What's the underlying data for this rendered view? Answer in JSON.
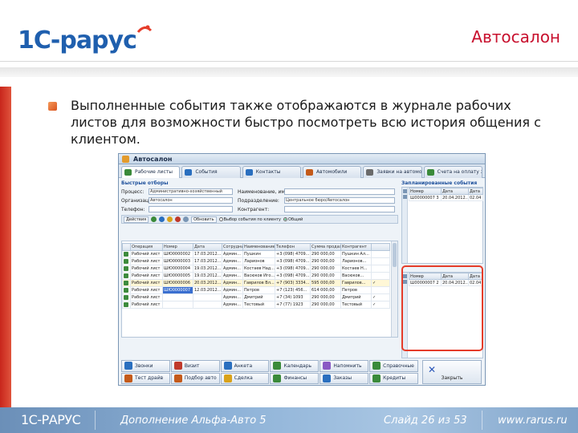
{
  "slide": {
    "logo_text": "1С-РАРУС",
    "title": "Автосалон",
    "bullet": "Выполненные события также отображаются в журнале рабочих листов для возможности быстро посмотреть всю история общения с клиентом."
  },
  "window": {
    "title": "Автосалон",
    "tabs": [
      {
        "label": "Рабочие листы",
        "icon_color": "#3a8a3a"
      },
      {
        "label": "События",
        "icon_color": "#2a6fbf"
      },
      {
        "label": "Контакты",
        "icon_color": "#2a6fbf"
      },
      {
        "label": "Автомобили",
        "icon_color": "#c45a1a"
      },
      {
        "label": "Заявки на автомобиль",
        "icon_color": "#6a6a6a"
      },
      {
        "label": "Счета на оплату за автомобиль",
        "icon_color": "#3a8a3a"
      }
    ],
    "filters": {
      "section_title": "Быстрые отборы",
      "rows": [
        {
          "label": "Процесс:",
          "value": "Административно-хозяйственный",
          "label2": "Наименование, имени:",
          "value2": ""
        },
        {
          "label": "Организация:",
          "value": "Автосалон",
          "label2": "Подразделение:",
          "value2": "Центральное бюро/Автосалон"
        },
        {
          "label": "Телефон:",
          "value": "",
          "label2": "Контрагент:",
          "value2": ""
        }
      ]
    },
    "toolbar": {
      "actions_label": "Действия",
      "refresh_label": "Обновить",
      "radio1": "Выбор события по клиенту",
      "radio2": "Общий"
    },
    "grid": {
      "columns": [
        "",
        "Операция",
        "Номер",
        "Дата",
        "Сотрудник",
        "Наименование",
        "Телефон",
        "Сумма продажи",
        "Контрагент",
        ""
      ],
      "rows": [
        {
          "op": "Рабочий лист",
          "num": "ШЮ0000002",
          "date": "17.03.2012...",
          "emp": "Админ...",
          "name": "Пушкин",
          "phone": "+3 (098) 4709...",
          "sum": "290 000,00",
          "cp": "Пушкин Ал...",
          "flag": ""
        },
        {
          "op": "Рабочий лист",
          "num": "ШЮ0000003",
          "date": "17.03.2012...",
          "emp": "Админ...",
          "name": "Ларионов",
          "phone": "+3 (098) 4709...",
          "sum": "290 000,00",
          "cp": "Ларионов...",
          "flag": ""
        },
        {
          "op": "Рабочий лист",
          "num": "ШЮ0000004",
          "date": "19.03.2012...",
          "emp": "Админ...",
          "name": "Костаев Над...",
          "phone": "+3 (098) 4709...",
          "sum": "290 000,00",
          "cp": "Костаев Н...",
          "flag": ""
        },
        {
          "op": "Рабочий лист",
          "num": "ШЮ0000005",
          "date": "19.03.2012...",
          "emp": "Админ...",
          "name": "Васюков Иго...",
          "phone": "+3 (098) 4709...",
          "sum": "290 000,00",
          "cp": "Васюков...",
          "flag": ""
        },
        {
          "op": "Рабочий лист",
          "num": "ШЮ0000006",
          "date": "20.03.2012...",
          "emp": "Админ...",
          "name": "Гаврилов Вл...",
          "phone": "+7 (903) 3334...",
          "sum": "595 000,00",
          "cp": "Гаврилов...",
          "flag": "✓"
        },
        {
          "op": "Рабочий лист",
          "num": "ШЮ0000007",
          "date": "12.03.2012...",
          "emp": "Админ...",
          "name": "Петров",
          "phone": "+7 (123) 456...",
          "sum": "614 000,00",
          "cp": "Петров",
          "flag": ""
        },
        {
          "op": "Рабочий лист",
          "num": "",
          "date": "",
          "emp": "Админ...",
          "name": "Дмитрий",
          "phone": "+7 (34) 1093",
          "sum": "290 000,00",
          "cp": "Дмитрий",
          "flag": "✓"
        },
        {
          "op": "Рабочий лист",
          "num": "",
          "date": "",
          "emp": "Админ...",
          "name": "Тестовый",
          "phone": "+7 (77) 1923",
          "sum": "290 000,00",
          "cp": "Тестовый",
          "flag": "✓"
        }
      ]
    },
    "events": {
      "section_title": "Запланированные события",
      "columns": [
        "Номер",
        "Дата",
        "Дата"
      ],
      "top_rows": [
        {
          "num": "Ш00000007 3",
          "date": "20.04.2012...",
          "date2": "02.04"
        }
      ],
      "bottom_rows": [
        {
          "num": "Ш00000007 2",
          "date": "20.04.2012...",
          "date2": "02.04"
        }
      ]
    },
    "bottom_buttons": [
      {
        "label": "Звонки",
        "icon_color": "#2a6fbf"
      },
      {
        "label": "Визит",
        "icon_color": "#c0392b"
      },
      {
        "label": "Анкета",
        "icon_color": "#2a6fbf"
      },
      {
        "label": "Календарь",
        "icon_color": "#3a8a3a"
      },
      {
        "label": "Напомнить",
        "icon_color": "#8a5ac4"
      },
      {
        "label": "Справочные",
        "icon_color": "#3a8a3a"
      },
      {
        "label": "Тест драйв",
        "icon_color": "#c45a1a"
      },
      {
        "label": "Подбор авто",
        "icon_color": "#c45a1a"
      },
      {
        "label": "Сделка",
        "icon_color": "#d9a21a"
      },
      {
        "label": "Финансы",
        "icon_color": "#3a8a3a"
      },
      {
        "label": "Заказы",
        "icon_color": "#2a6fbf"
      },
      {
        "label": "Кредиты",
        "icon_color": "#3a8a3a"
      }
    ],
    "close_label": "Закрыть"
  },
  "footer": {
    "logo": "1С-РАРУС",
    "product": "Дополнение Альфа-Авто 5",
    "slide_num": "Слайд 26 из 53",
    "site": "www.rarus.ru"
  }
}
